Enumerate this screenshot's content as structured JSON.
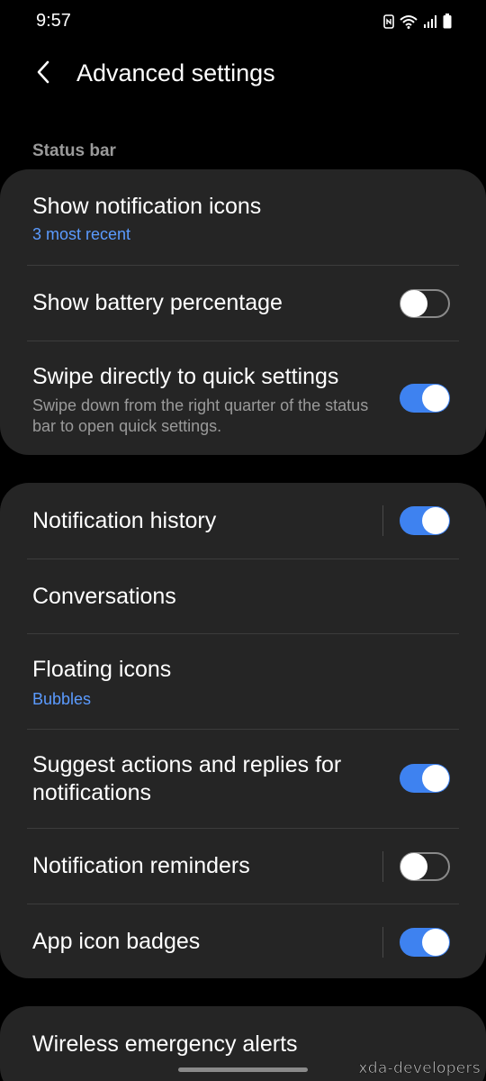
{
  "status_bar": {
    "time": "9:57",
    "icons": [
      "nfc-icon",
      "wifi-icon",
      "signal-icon",
      "battery-icon"
    ]
  },
  "header": {
    "title": "Advanced settings",
    "back_icon": "chevron-left-icon"
  },
  "status_bar_section": {
    "label": "Status bar",
    "items": [
      {
        "title": "Show notification icons",
        "subtitle": "3 most recent"
      },
      {
        "title": "Show battery percentage",
        "toggle": false
      },
      {
        "title": "Swipe directly to quick settings",
        "description": "Swipe down from the right quarter of the status bar to open quick settings.",
        "toggle": true
      }
    ]
  },
  "notifications_section": {
    "items": [
      {
        "title": "Notification history",
        "toggle": true
      },
      {
        "title": "Conversations"
      },
      {
        "title": "Floating icons",
        "subtitle": "Bubbles"
      },
      {
        "title": "Suggest actions and replies for notifications",
        "toggle": true
      },
      {
        "title": "Notification reminders",
        "toggle": false
      },
      {
        "title": "App icon badges",
        "toggle": true
      }
    ]
  },
  "alerts_section": {
    "items": [
      {
        "title": "Wireless emergency alerts"
      }
    ]
  },
  "watermark": "xda-developers",
  "colors": {
    "background": "#000000",
    "card": "#252525",
    "accent": "#3e82f0",
    "subtitle": "#5b9bff",
    "secondary_text": "#9a9a9a"
  }
}
